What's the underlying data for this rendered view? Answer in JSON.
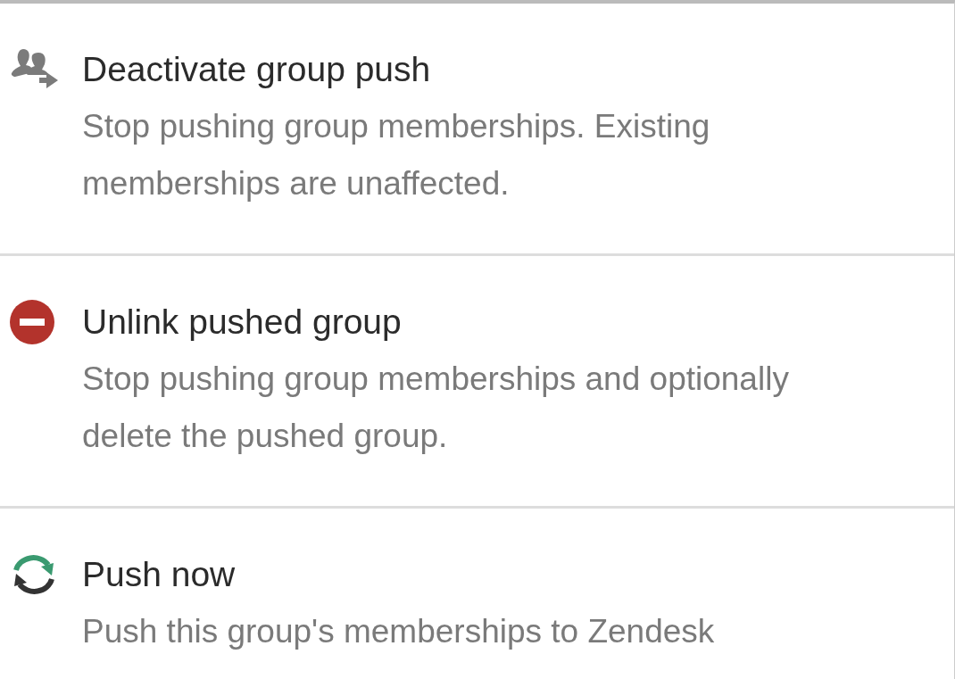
{
  "menu": {
    "items": [
      {
        "kind": "group-push",
        "title": "Deactivate group push",
        "description": "Stop pushing group memberships. Existing memberships are unaffected."
      },
      {
        "kind": "unlink",
        "title": "Unlink pushed group",
        "description": "Stop pushing group memberships and optionally delete the pushed group."
      },
      {
        "kind": "sync",
        "title": "Push now",
        "description": "Push this group's memberships to Zendesk"
      }
    ]
  }
}
